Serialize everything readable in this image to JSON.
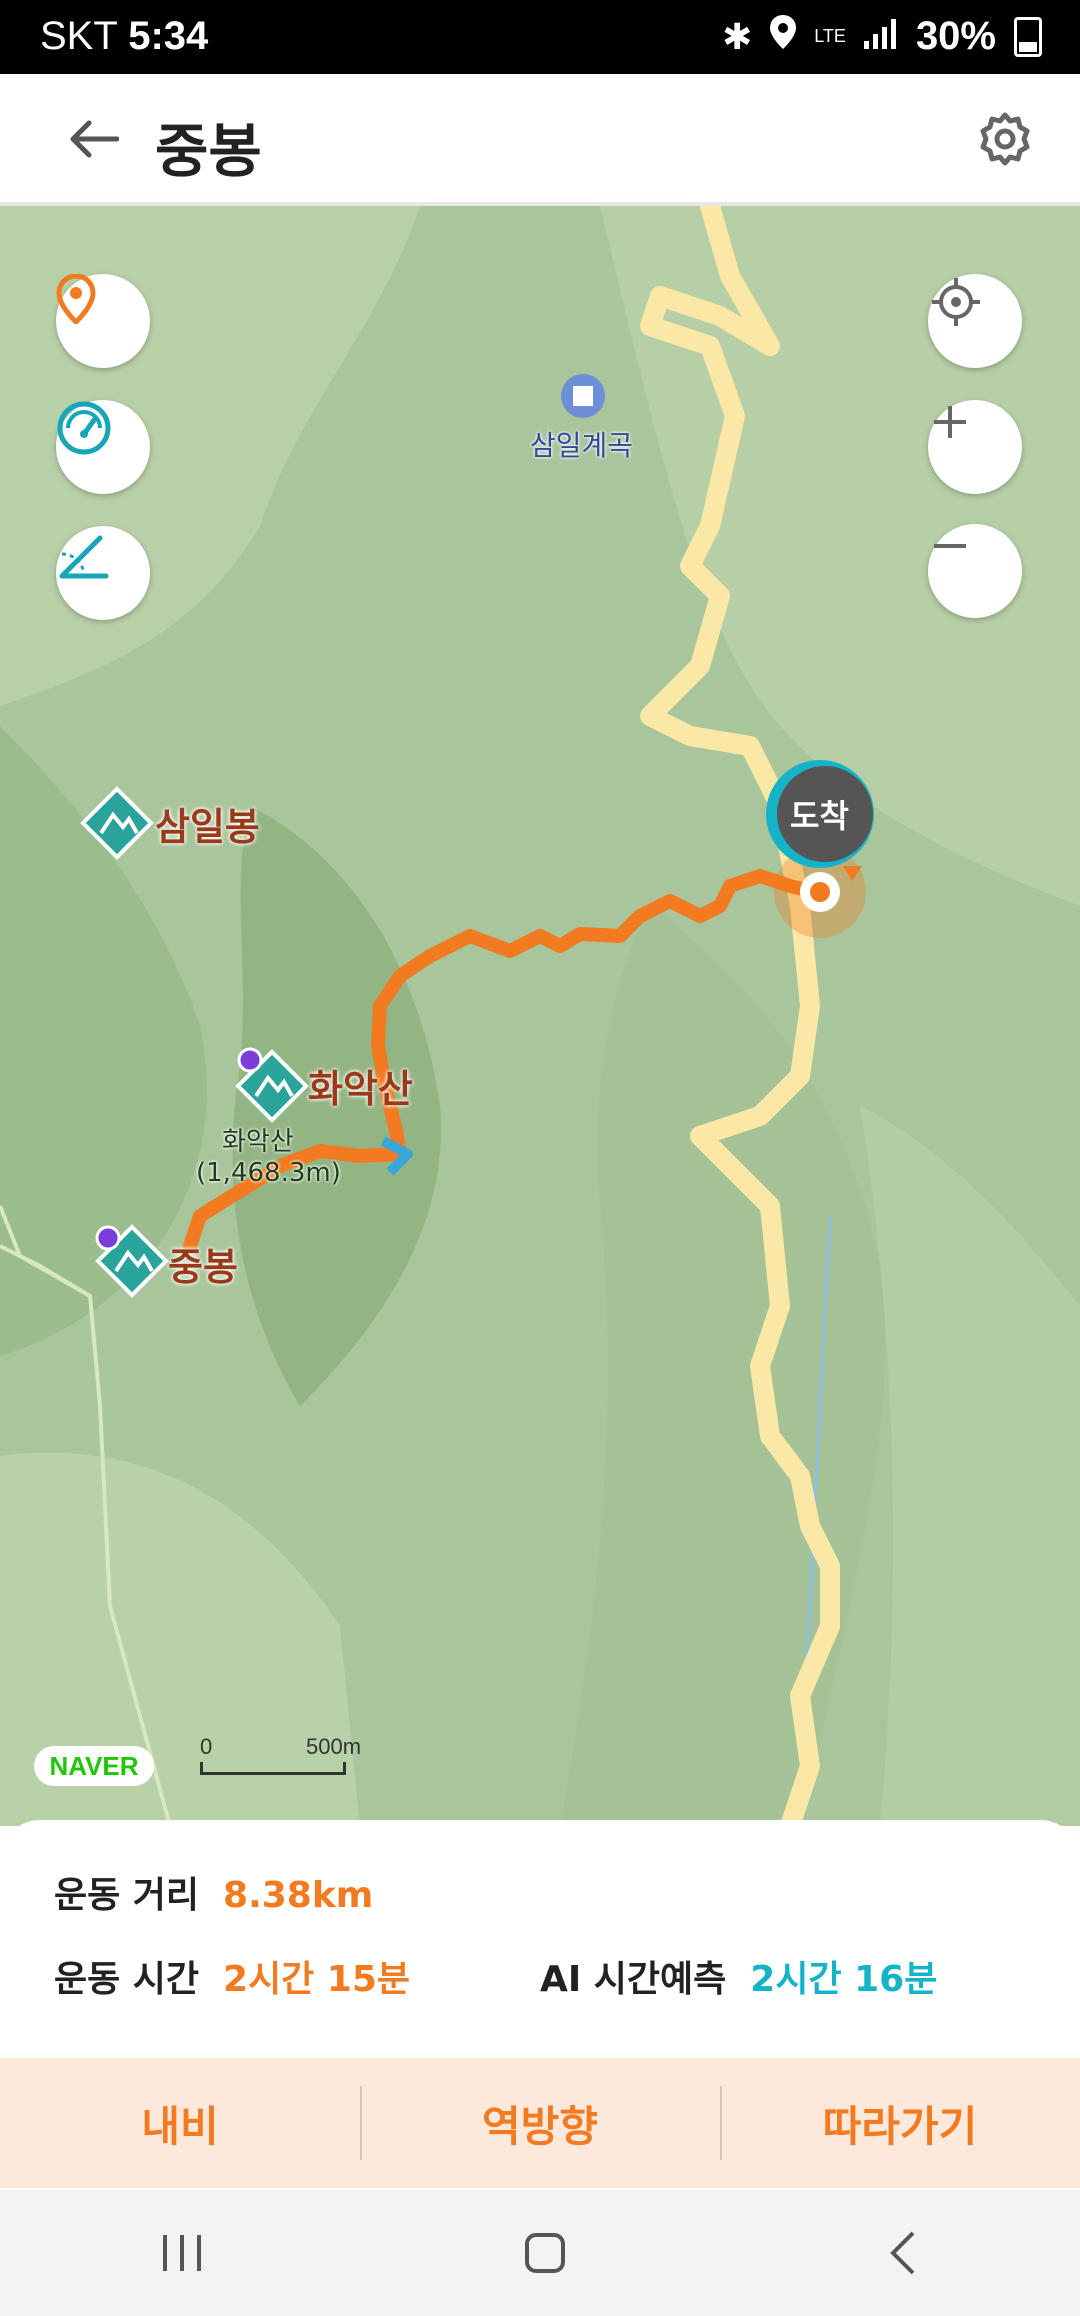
{
  "status_bar": {
    "carrier": "SKT",
    "time": "5:34",
    "network": "LTE",
    "battery": "30%"
  },
  "header": {
    "title": "중봉",
    "back_icon": "arrow-left-icon",
    "settings_icon": "gear-icon"
  },
  "map": {
    "labels": {
      "samil_valley": "삼일계곡",
      "samilbong": "삼일봉",
      "hwaaksan": "화악산",
      "hwaaksan_small": "화악산",
      "hwaaksan_elev": "(1,468.3m)",
      "jungbong": "중봉",
      "arrival": "도착"
    },
    "brand": "NAVER",
    "scale": {
      "zero": "0",
      "distance": "500m"
    }
  },
  "stats": {
    "distance_label": "운동 거리",
    "distance_value": "8.38km",
    "time_label": "운동 시간",
    "time_value": "2시간 15분",
    "ai_label": "AI 시간예측",
    "ai_value": "2시간 16분"
  },
  "actions": {
    "navi": "내비",
    "reverse": "역방향",
    "follow": "따라가기"
  },
  "colors": {
    "route": "#f27a20",
    "road": "#fbe7a6",
    "accent_teal": "#15b3c7"
  }
}
